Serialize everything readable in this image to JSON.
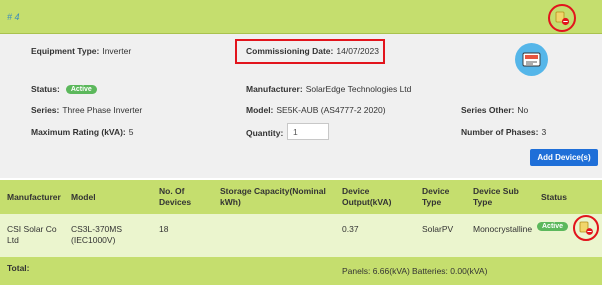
{
  "header": {
    "title": "# 4",
    "edit_icon": "edit-pencil-icon"
  },
  "details": {
    "equipment_type_label": "Equipment Type:",
    "equipment_type": "Inverter",
    "commissioning_date_label": "Commissioning Date:",
    "commissioning_date": "14/07/2023",
    "status_label": "Status:",
    "status": "Active",
    "manufacturer_label": "Manufacturer:",
    "manufacturer": "SolarEdge Technologies Ltd",
    "series_label": "Series:",
    "series": "Three Phase Inverter",
    "model_label": "Model:",
    "model": "SE5K-AUB (AS4777-2 2020)",
    "series_other_label": "Series Other:",
    "series_other": "No",
    "max_rating_label": "Maximum Rating (kVA):",
    "max_rating": "5",
    "quantity_label": "Quantity:",
    "quantity": "1",
    "phases_label": "Number of Phases:",
    "phases": "3",
    "device_icon": "inverter-device-icon"
  },
  "add_button": "Add Device(s)",
  "table": {
    "headers": {
      "manufacturer": "Manufacturer",
      "model": "Model",
      "devices": "No. Of\nDevices",
      "storage": "Storage Capacity(Nominal\nkWh)",
      "output": "Device\nOutput(kVA)",
      "type": "Device\nType",
      "subtype": "Device Sub\nType",
      "status": "Status"
    },
    "row": {
      "manufacturer": "CSI Solar Co\nLtd",
      "model": "CS3L-370MS\n(IEC1000V)",
      "devices": "18",
      "storage": "",
      "output": "0.37",
      "type": "SolarPV",
      "subtype": "Monocrystalline",
      "status": "Active"
    },
    "total_label": "Total:",
    "panels": "Panels: 6.66(kVA)",
    "batteries": "Batteries: 0.00(kVA)"
  },
  "colors": {
    "header_green": "#c5de6e",
    "row_green": "#ebf5ce",
    "highlight_red": "#e2141c",
    "active_green": "#5cb85c",
    "primary_blue": "#1f6fd8"
  }
}
